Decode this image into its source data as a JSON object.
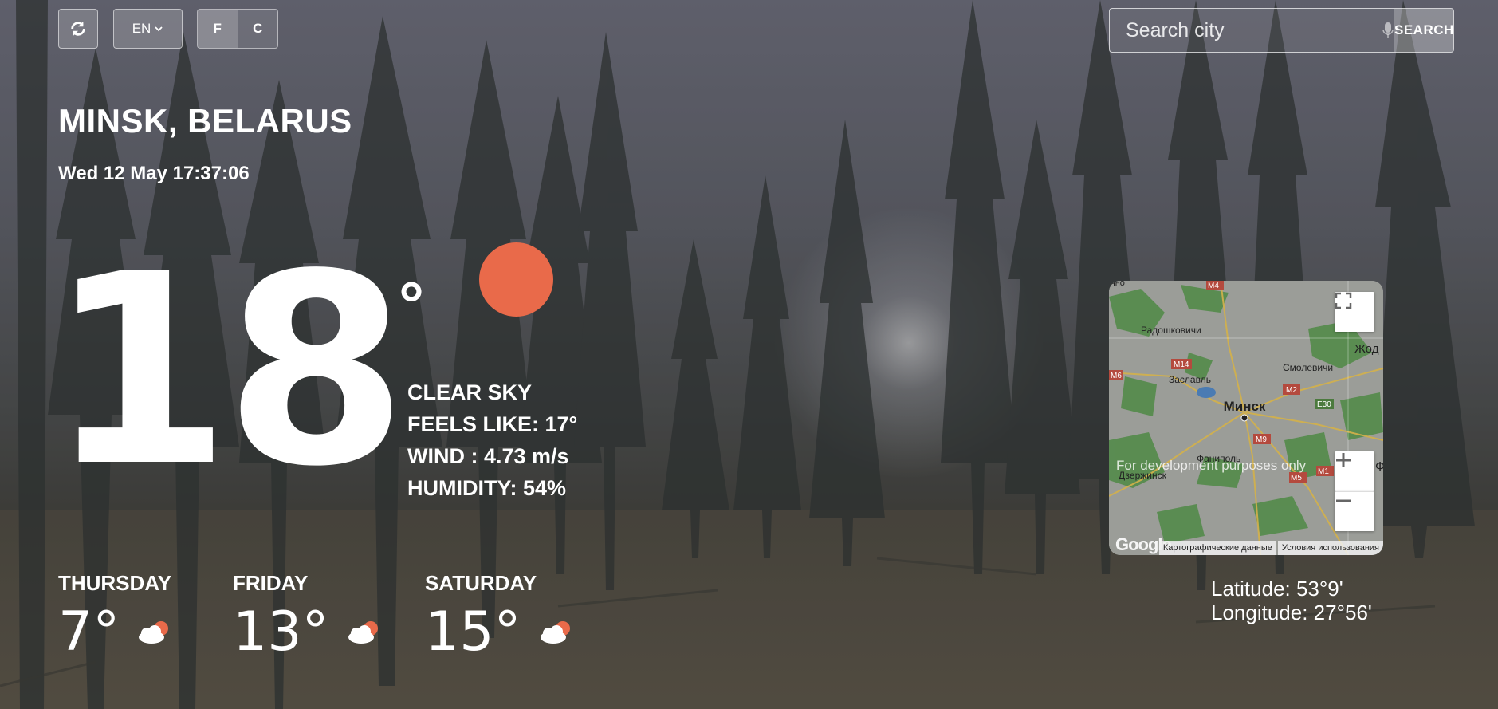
{
  "toolbar": {
    "refresh_icon": "refresh-icon",
    "language": "EN",
    "unit_f": "F",
    "unit_c": "C"
  },
  "search": {
    "placeholder": "Search city",
    "button_label": "SEARCH",
    "mic_icon": "microphone-icon"
  },
  "location": {
    "city": "MINSK, BELARUS",
    "datetime": "Wed 12 May 17:37:06"
  },
  "current": {
    "temperature": "18",
    "degree": "°",
    "icon": "sun-icon",
    "icon_color": "#e96a4a",
    "condition": "CLEAR SKY",
    "feels_like": "FEELS LIKE: 17°",
    "wind": "WIND : 4.73 m/s",
    "humidity": "HUMIDITY: 54%"
  },
  "forecast": [
    {
      "day": "THURSDAY",
      "temp": "7°",
      "icon": "partly-cloudy-icon"
    },
    {
      "day": "FRIDAY",
      "temp": "13°",
      "icon": "partly-cloudy-icon"
    },
    {
      "day": "SATURDAY",
      "temp": "15°",
      "icon": "partly-cloudy-icon"
    }
  ],
  "map": {
    "dev_notice": "For development purposes only",
    "footer_data": "Картографические данные",
    "footer_terms": "Условия использования",
    "logo": "Google",
    "labels": {
      "minsk": "Минск",
      "radoshkovichi": "Радошковичи",
      "zaslavl": "Заславль",
      "smolevichi": "Смолевичи",
      "fanipol": "Фаниполь",
      "dzerzhinsk": "Дзержинск",
      "zhodino": "Жод",
      "top_partial": "чно",
      "right_partial": "Ф",
      "m14": "M14",
      "m6": "M6",
      "m2": "M2",
      "e30": "E30",
      "m9": "M9",
      "m1": "M1",
      "m5": "M5",
      "m4": "M4"
    }
  },
  "coordinates": {
    "latitude": "Latitude: 53°9'",
    "longitude": "Longitude: 27°56'"
  }
}
